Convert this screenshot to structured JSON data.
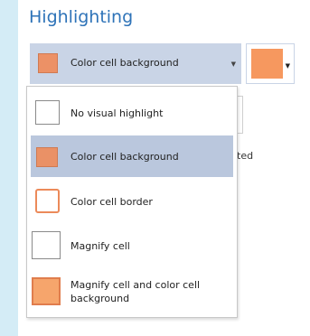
{
  "title": "Highlighting",
  "combo": {
    "selected_label": "Color cell background",
    "swatch_color": "#ec9166"
  },
  "color_button": {
    "color": "#f6985f"
  },
  "background_text": "ted",
  "dropdown": {
    "items": [
      {
        "label": "No visual highlight",
        "icon": "empty-square-icon",
        "selected": false
      },
      {
        "label": "Color cell background",
        "icon": "filled-orange-square-icon",
        "selected": true
      },
      {
        "label": "Color cell border",
        "icon": "orange-border-square-icon",
        "selected": false
      },
      {
        "label": "Magnify cell",
        "icon": "large-empty-square-icon",
        "selected": false
      },
      {
        "label": "Magnify cell and color cell background",
        "icon": "large-orange-square-icon",
        "selected": false
      }
    ]
  }
}
